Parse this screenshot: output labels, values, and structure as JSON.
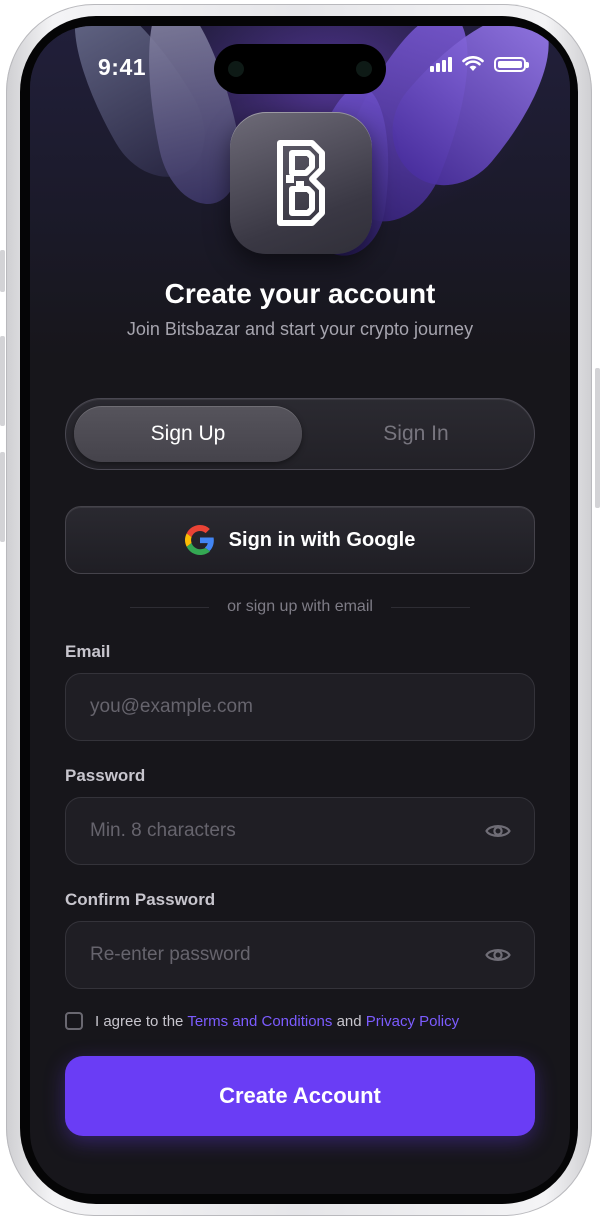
{
  "status_bar": {
    "time": "9:41"
  },
  "header": {
    "title": "Create your account",
    "subtitle": "Join Bitsbazar and start your crypto journey"
  },
  "auth_tabs": [
    {
      "label": "Sign Up",
      "active": true
    },
    {
      "label": "Sign In",
      "active": false
    }
  ],
  "google_button": {
    "label": "Sign in with Google"
  },
  "divider_text": "or sign up with email",
  "form": {
    "email": {
      "label": "Email",
      "placeholder": "you@example.com",
      "value": ""
    },
    "password": {
      "label": "Password",
      "placeholder": "Min. 8 characters",
      "value": ""
    },
    "confirm_password": {
      "label": "Confirm Password",
      "placeholder": "Re-enter password",
      "value": ""
    }
  },
  "agreement": {
    "prefix": "I agree to the",
    "terms_link": "Terms and Conditions",
    "middle": "and",
    "privacy_link": "Privacy Policy",
    "checked": false
  },
  "submit": {
    "label": "Create Account"
  },
  "colors": {
    "accent": "#6a3df5",
    "link": "#7c5cff",
    "background": "#17161b"
  }
}
